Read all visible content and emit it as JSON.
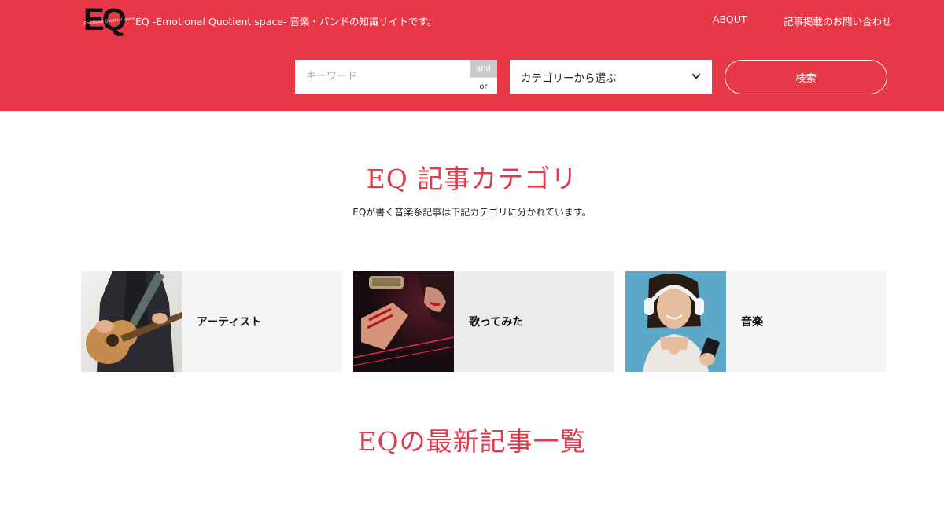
{
  "header": {
    "logo_text": "EQ",
    "logo_script": "Emotional Quotient space",
    "site_desc": "EQ -Emotional Quotient space- 音楽・バンドの知識サイトです。",
    "nav": {
      "about": "ABOUT",
      "contact": "記事掲載のお問い合わせ"
    },
    "search": {
      "keyword_placeholder": "キーワード",
      "and_label": "and",
      "or_label": "or",
      "category_selected": "カテゴリーから選ぶ",
      "search_label": "検索"
    }
  },
  "categories_section": {
    "title": "EQ 記事カテゴリ",
    "subtitle": "EQが書く音楽系記事は下記カテゴリに分かれています。",
    "cards": [
      {
        "label": "アーティスト",
        "image": "guitarist-photo"
      },
      {
        "label": "歌ってみた",
        "image": "singer-microphone-photo"
      },
      {
        "label": "音楽",
        "image": "woman-headphones-photo"
      }
    ]
  },
  "latest_section": {
    "title": "EQの最新記事一覧"
  },
  "colors": {
    "brand_red": "#e73848",
    "title_red": "#e33a4b",
    "card_bg": "#f5f5f5",
    "card_bg_alt": "#ececec"
  }
}
